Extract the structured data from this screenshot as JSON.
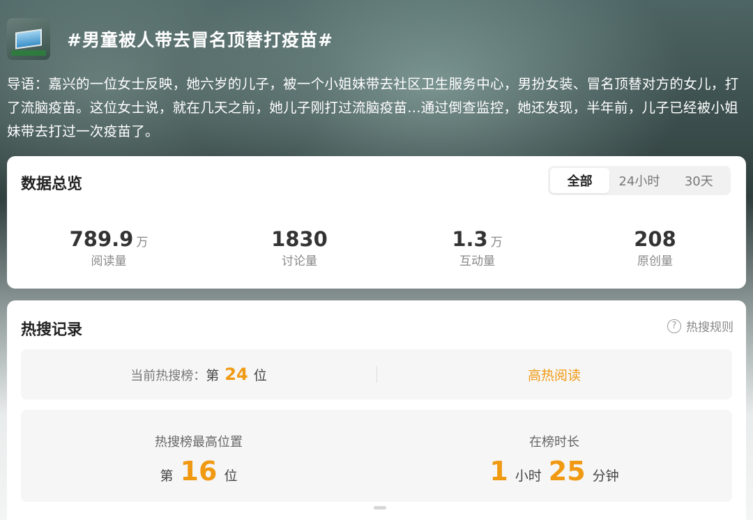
{
  "header": {
    "title": "#男童被人带去冒名顶替打疫苗#",
    "thumbnail_icon": "video-thumbnail"
  },
  "lead": {
    "text": "导语：嘉兴的一位女士反映，她六岁的儿子，被一个小姐妹带去社区卫生服务中心，男扮女装、冒名顶替对方的女儿，打了流脑疫苗。这位女士说，就在几天之前，她儿子刚打过流脑疫苗...通过倒查监控，她还发现，半年前，儿子已经被小姐妹带去打过一次疫苗了。"
  },
  "overview": {
    "title": "数据总览",
    "tabs": [
      {
        "label": "全部",
        "active": true
      },
      {
        "label": "24小时",
        "active": false
      },
      {
        "label": "30天",
        "active": false
      }
    ],
    "stats": [
      {
        "value": "789.9",
        "unit": "万",
        "label": "阅读量"
      },
      {
        "value": "1830",
        "unit": "",
        "label": "讨论量"
      },
      {
        "value": "1.3",
        "unit": "万",
        "label": "互动量"
      },
      {
        "value": "208",
        "unit": "",
        "label": "原创量"
      }
    ]
  },
  "hot": {
    "title": "热搜记录",
    "help_label": "热搜规则",
    "help_icon": "question-circle-icon",
    "current_label": "当前热搜榜：",
    "current_pre": "第",
    "current_rank": "24",
    "current_post": "位",
    "link_label": "高热阅读",
    "peak_label": "热搜榜最高位置",
    "peak_pre": "第",
    "peak_rank": "16",
    "peak_post": "位",
    "duration_label": "在榜时长",
    "duration_hours": "1",
    "duration_hours_unit": "小时",
    "duration_minutes": "25",
    "duration_minutes_unit": "分钟"
  },
  "colors": {
    "accent": "#f09a13",
    "card_bg": "#ffffff",
    "row_bg": "#f6f6f6"
  }
}
